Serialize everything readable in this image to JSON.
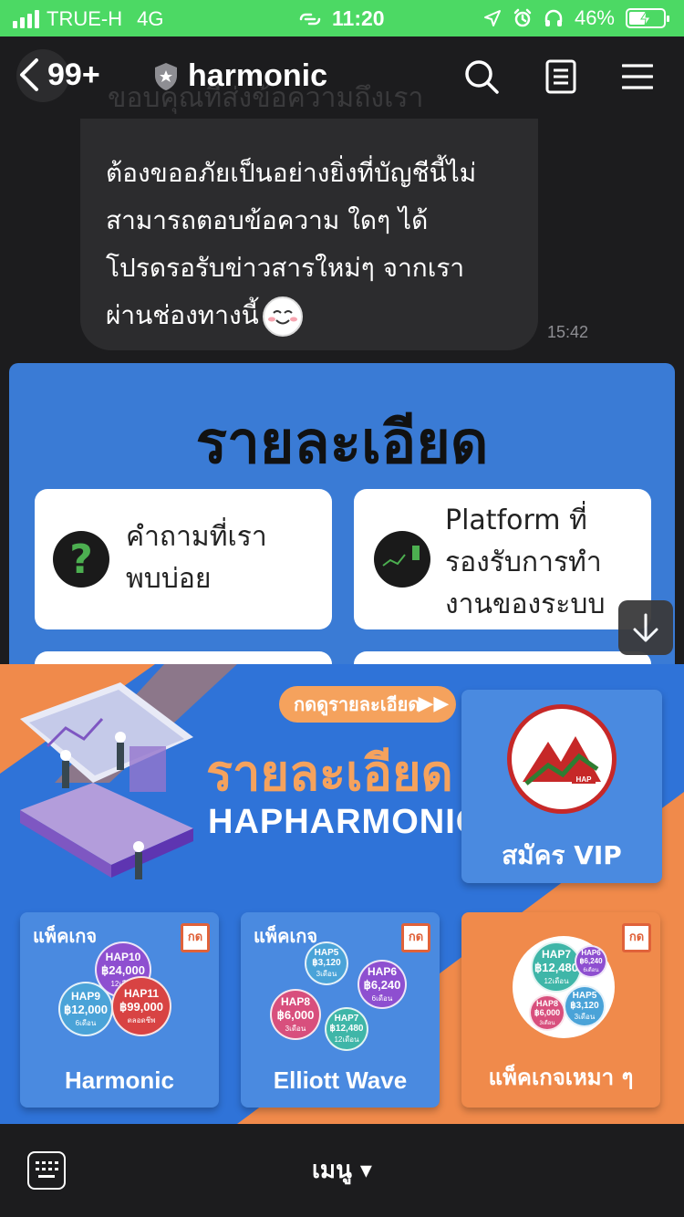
{
  "status": {
    "carrier": "TRUE-H",
    "network": "4G",
    "time": "11:20",
    "battery": "46%"
  },
  "nav": {
    "unread_count": "99+",
    "title": "harmonic",
    "ghost_text": "ขอบคุณที่ส่งข้อความถึงเรา"
  },
  "message": {
    "lines": [
      "ต้องขออภัยเป็นอย่างยิ่งที่บัญชีนี้ไม่",
      "สามารถตอบข้อความ ใดๆ ได้",
      "โปรดรอรับข่าวสารใหม่ๆ จากเรา",
      "ผ่านช่องทางนี้"
    ],
    "time": "15:42"
  },
  "rich_card": {
    "title": "รายละเอียด",
    "buttons": [
      {
        "line1": "คำถามที่เรา",
        "line2": "พบบ่อย"
      },
      {
        "line1": "Platform ที่",
        "line2": "รองรับการทำ",
        "line3": "งานของระบบ"
      }
    ]
  },
  "banner": {
    "cta": "กดดูรายละเอียด",
    "title": "รายละเอียด",
    "subtitle": "HAPHARMONIC",
    "vip_label": "สมัคร VIP",
    "vip_logo_text": "HAP",
    "packages": [
      {
        "label": "แพ็คเกจ",
        "name": "Harmonic",
        "tag": "กด",
        "plans": [
          {
            "code": "HAP10",
            "price": "฿24,000",
            "duration": "12เดือน"
          },
          {
            "code": "HAP9",
            "price": "฿12,000",
            "duration": "6เดือน"
          },
          {
            "code": "HAP11",
            "price": "฿99,000",
            "duration": "ตลอดชีพ"
          }
        ]
      },
      {
        "label": "แพ็คเกจ",
        "name": "Elliott Wave",
        "tag": "กด",
        "plans": [
          {
            "code": "HAP5",
            "price": "฿3,120",
            "duration": "3เดือน"
          },
          {
            "code": "HAP6",
            "price": "฿6,240",
            "duration": "6เดือน"
          },
          {
            "code": "HAP8",
            "price": "฿6,000",
            "duration": "3เดือน"
          },
          {
            "code": "HAP7",
            "price": "฿12,480",
            "duration": "12เดือน"
          }
        ]
      },
      {
        "label": "",
        "name": "แพ็คเกจเหมา ๆ",
        "tag": "กด",
        "plans": [
          {
            "code": "HAP7",
            "price": "฿12,480",
            "duration": "12เดือน"
          },
          {
            "code": "HAP6",
            "price": "฿6,240",
            "duration": "6เดือน"
          },
          {
            "code": "HAP8",
            "price": "฿6,000",
            "duration": "3เดือน"
          },
          {
            "code": "HAP5",
            "price": "฿3,120",
            "duration": "3เดือน"
          }
        ]
      }
    ]
  },
  "bottom": {
    "menu_label": "เมนู ▾"
  },
  "colors": {
    "status_green": "#4cd964",
    "chat_bg": "#1c1c1e",
    "bubble_bg": "#2c2c2e",
    "banner_blue": "#2f73d8",
    "banner_orange": "#f08a4b"
  }
}
